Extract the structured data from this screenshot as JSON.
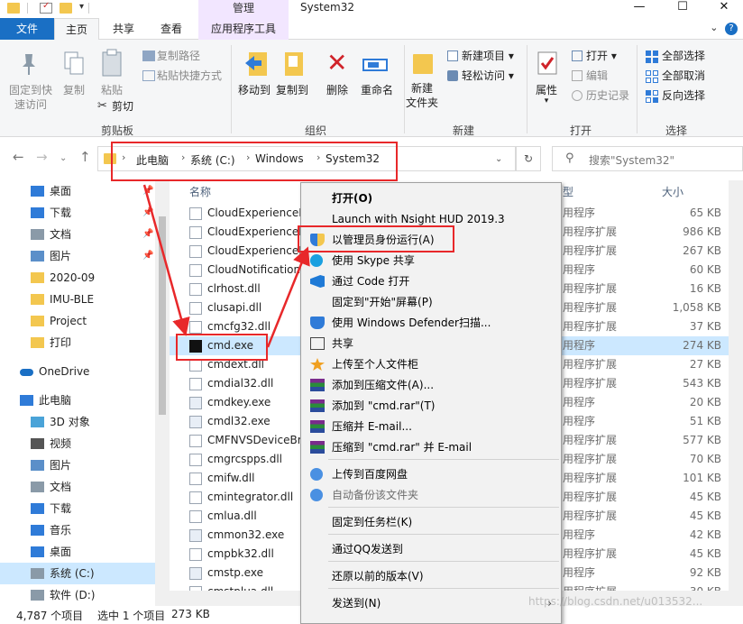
{
  "titlebar": {
    "manage_tab": "管理",
    "window_title": "System32",
    "min": "—",
    "max": "☐",
    "close": "✕"
  },
  "ribbon_tabs": {
    "file": "文件",
    "home": "主页",
    "share": "共享",
    "view": "查看",
    "app_tools": "应用程序工具"
  },
  "ribbon": {
    "clipboard": {
      "label": "剪贴板",
      "pin_quick_access": [
        "固定到快",
        "速访问"
      ],
      "copy": "复制",
      "paste": "粘贴",
      "copy_path": "复制路径",
      "paste_shortcut": "粘贴快捷方式",
      "cut": "剪切"
    },
    "organize": {
      "label": "组织",
      "move_to": "移动到",
      "copy_to": "复制到",
      "delete": "删除",
      "rename": "重命名"
    },
    "new": {
      "label": "新建",
      "new_folder": [
        "新建",
        "文件夹"
      ],
      "new_item": "新建项目",
      "easy_access": "轻松访问"
    },
    "open": {
      "label": "打开",
      "properties": "属性",
      "open": "打开",
      "edit": "编辑",
      "history": "历史记录"
    },
    "select": {
      "label": "选择",
      "select_all": "全部选择",
      "select_none": "全部取消",
      "invert": "反向选择"
    }
  },
  "address": {
    "crumbs": [
      "此电脑",
      "系统 (C:)",
      "Windows",
      "System32"
    ],
    "search_placeholder": "搜索\"System32\""
  },
  "nav_pane": {
    "items": [
      {
        "label": "桌面",
        "icon": "desktop-icon"
      },
      {
        "label": "下载",
        "icon": "download-icon"
      },
      {
        "label": "文档",
        "icon": "document-icon"
      },
      {
        "label": "图片",
        "icon": "picture-icon"
      },
      {
        "label": "2020-09",
        "icon": "folder-icon"
      },
      {
        "label": "IMU-BLE",
        "icon": "folder-icon"
      },
      {
        "label": "Project",
        "icon": "folder-icon"
      },
      {
        "label": "打印",
        "icon": "folder-icon"
      },
      {
        "label": "OneDrive",
        "icon": "cloud-icon"
      },
      {
        "label": "此电脑",
        "icon": "computer-icon"
      },
      {
        "label": "3D 对象",
        "icon": "cube-icon"
      },
      {
        "label": "视频",
        "icon": "video-icon"
      },
      {
        "label": "图片",
        "icon": "picture-icon"
      },
      {
        "label": "文档",
        "icon": "document-icon"
      },
      {
        "label": "下载",
        "icon": "download-icon"
      },
      {
        "label": "音乐",
        "icon": "music-icon"
      },
      {
        "label": "桌面",
        "icon": "desktop-icon"
      },
      {
        "label": "系统 (C:)",
        "icon": "drive-icon"
      },
      {
        "label": "软件 (D:)",
        "icon": "drive-icon"
      }
    ]
  },
  "filelist": {
    "col_name": "名称",
    "col_type": "型",
    "col_size": "大小",
    "rows": [
      {
        "name": "CloudExperienceH",
        "type": "用程序",
        "size": "65 KB"
      },
      {
        "name": "CloudExperienceH",
        "type": "用程序扩展",
        "size": "986 KB"
      },
      {
        "name": "CloudExperienceH",
        "type": "用程序扩展",
        "size": "267 KB"
      },
      {
        "name": "CloudNotification",
        "type": "用程序",
        "size": "60 KB"
      },
      {
        "name": "clrhost.dll",
        "type": "用程序扩展",
        "size": "16 KB"
      },
      {
        "name": "clusapi.dll",
        "type": "用程序扩展",
        "size": "1,058 KB"
      },
      {
        "name": "cmcfg32.dll",
        "type": "用程序扩展",
        "size": "37 KB"
      },
      {
        "name": "cmd.exe",
        "type": "用程序",
        "size": "274 KB"
      },
      {
        "name": "cmdext.dll",
        "type": "用程序扩展",
        "size": "27 KB"
      },
      {
        "name": "cmdial32.dll",
        "type": "用程序扩展",
        "size": "543 KB"
      },
      {
        "name": "cmdkey.exe",
        "type": "用程序",
        "size": "20 KB"
      },
      {
        "name": "cmdl32.exe",
        "type": "用程序",
        "size": "51 KB"
      },
      {
        "name": "CMFNVSDeviceBr",
        "type": "用程序扩展",
        "size": "577 KB"
      },
      {
        "name": "cmgrcspps.dll",
        "type": "用程序扩展",
        "size": "70 KB"
      },
      {
        "name": "cmifw.dll",
        "type": "用程序扩展",
        "size": "101 KB"
      },
      {
        "name": "cmintegrator.dll",
        "type": "用程序扩展",
        "size": "45 KB"
      },
      {
        "name": "cmlua.dll",
        "type": "用程序扩展",
        "size": "45 KB"
      },
      {
        "name": "cmmon32.exe",
        "type": "用程序",
        "size": "42 KB"
      },
      {
        "name": "cmpbk32.dll",
        "type": "用程序扩展",
        "size": "45 KB"
      },
      {
        "name": "cmstp.exe",
        "type": "用程序",
        "size": "92 KB"
      },
      {
        "name": "cmstplua.dll",
        "type": "用程序扩展",
        "size": "30 KB"
      }
    ]
  },
  "context_menu": {
    "items": [
      {
        "label": "打开(O)",
        "bold": true
      },
      {
        "label": "Launch with Nsight HUD 2019.3"
      },
      {
        "label": "以管理员身份运行(A)",
        "icon": "shield-icon"
      },
      {
        "label": "使用 Skype 共享",
        "icon": "skype-icon"
      },
      {
        "label": "通过 Code 打开",
        "icon": "vscode-icon"
      },
      {
        "label": "固定到\"开始\"屏幕(P)"
      },
      {
        "label": "使用 Windows Defender扫描...",
        "icon": "defender-icon"
      },
      {
        "label": "共享",
        "icon": "share-icon"
      },
      {
        "label": "上传至个人文件柜",
        "icon": "star-icon"
      },
      {
        "label": "添加到压缩文件(A)...",
        "icon": "winrar-icon"
      },
      {
        "label": "添加到 \"cmd.rar\"(T)",
        "icon": "winrar-icon"
      },
      {
        "label": "压缩并 E-mail...",
        "icon": "winrar-icon"
      },
      {
        "label": "压缩到 \"cmd.rar\" 并 E-mail",
        "icon": "winrar-icon"
      },
      {
        "label": "上传到百度网盘",
        "icon": "baidu-icon"
      },
      {
        "label": "自动备份该文件夹",
        "icon": "baidu-icon",
        "gray": true
      },
      {
        "label": "固定到任务栏(K)"
      },
      {
        "label": "通过QQ发送到"
      },
      {
        "label": "还原以前的版本(V)"
      },
      {
        "label": "发送到(N)",
        "submenu": true
      }
    ]
  },
  "status": {
    "count": "4,787 个项目",
    "selected": "选中 1 个项目",
    "size": "273 KB"
  },
  "watermark": "https://blog.csdn.net/u013532..."
}
